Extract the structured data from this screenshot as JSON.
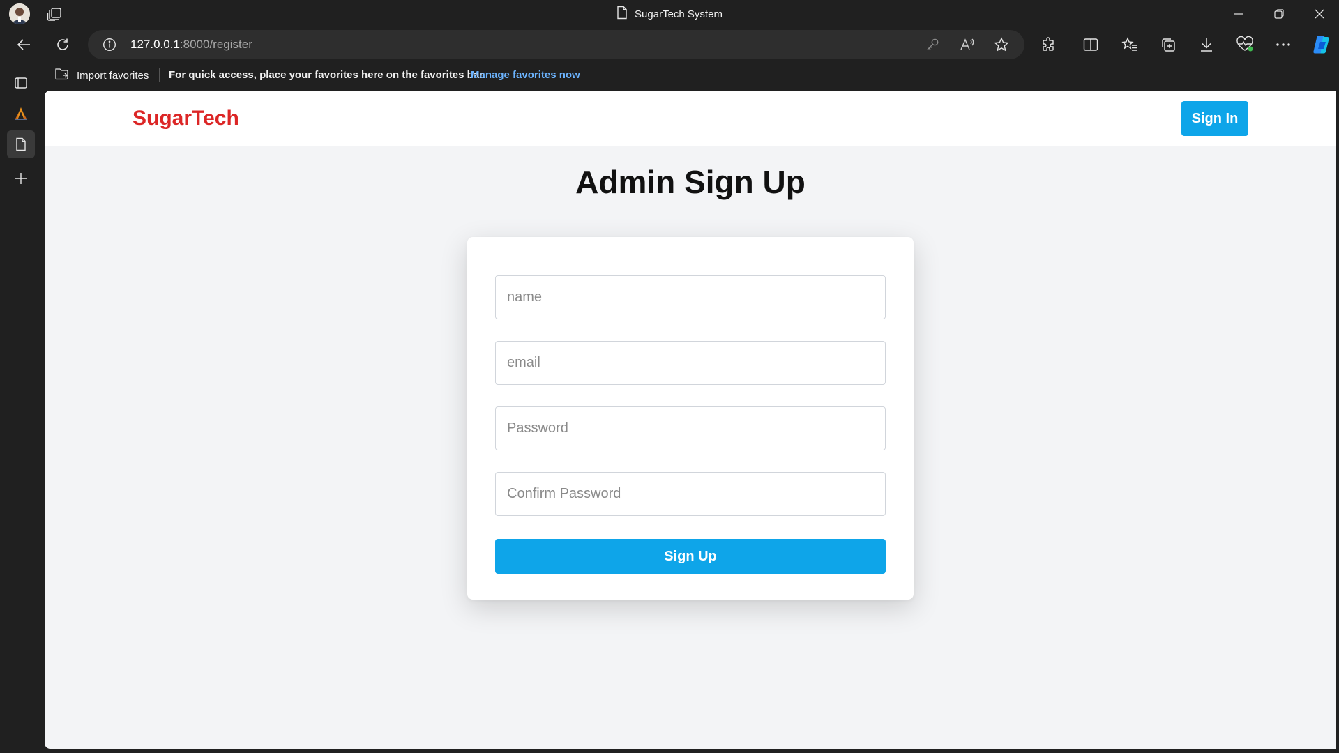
{
  "window": {
    "title": "SugarTech System"
  },
  "address_bar": {
    "url_host": "127.0.0.1",
    "url_rest": ":8000/register"
  },
  "favorites_bar": {
    "import_label": "Import favorites",
    "message": "For quick access, place your favorites here on the favorites bar.",
    "manage_link": "Manage favorites now"
  },
  "toolbar_icons": [
    "key-icon",
    "read-aloud-icon",
    "favorite-star-icon",
    "extensions-icon",
    "split-screen-icon",
    "favorites-icon",
    "collections-icon",
    "downloads-icon",
    "browser-essentials-icon",
    "more-icon",
    "copilot-icon"
  ],
  "site": {
    "brand": "SugarTech",
    "signin_label": "Sign In"
  },
  "form": {
    "title": "Admin Sign Up",
    "fields": [
      {
        "placeholder": "name",
        "value": ""
      },
      {
        "placeholder": "email",
        "value": ""
      },
      {
        "placeholder": "Password",
        "value": ""
      },
      {
        "placeholder": "Confirm Password",
        "value": ""
      }
    ],
    "submit_label": "Sign Up"
  },
  "colors": {
    "brand": "#dc2626",
    "accent": "#0ea5e9",
    "page_background": "#f3f4f6",
    "browser_chrome": "#202020"
  }
}
